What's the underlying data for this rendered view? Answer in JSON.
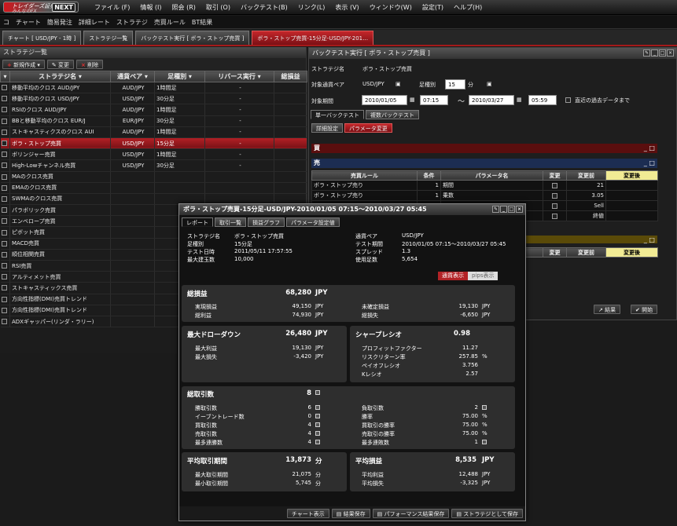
{
  "app": {
    "logo_line1": "トレイダーズ証券",
    "logo_line2": "みんなのFX",
    "logo_badge": "NEXT"
  },
  "menu": [
    "ファイル (F)",
    "情報 (I)",
    "照会 (R)",
    "取引 (O)",
    "バックテスト(B)",
    "リンク(L)",
    "表示 (V)",
    "ウィンドウ(W)",
    "設定(T)",
    "ヘルプ(H)"
  ],
  "toolbar": [
    "コ",
    "チャート",
    "簡易発注",
    "詳細レート",
    "ストラテジ",
    "売買ルール",
    "BT結果"
  ],
  "doc_tabs": [
    "チャート [ USD/JPY - 1時 ]",
    "ストラテジ一覧",
    "バックテスト実行 [ ボラ・ストップ売買 ]",
    "ボラ・ストップ売買-15分足-USD/JPY-201…"
  ],
  "strategy_list": {
    "title": "ストラテジ一覧",
    "new_label": "新規作成",
    "edit_label": "変更",
    "delete_label": "削除",
    "headers": [
      "ストラテジ名",
      "通貨ペア",
      "足種別",
      "リバース実行",
      "総損益"
    ],
    "rows": [
      {
        "name": "移動平均のクロス AUD/JPY",
        "pair": "AUD/JPY",
        "bar": "1時間足",
        "rev": "-"
      },
      {
        "name": "移動平均のクロス USD/JPY",
        "pair": "USD/JPY",
        "bar": "30分足",
        "rev": "-"
      },
      {
        "name": "RSIのクロス AUD/JPY",
        "pair": "AUD/JPY",
        "bar": "1時間足",
        "rev": "-"
      },
      {
        "name": "BBと移動平均のクロス EUR/J",
        "pair": "EUR/JPY",
        "bar": "30分足",
        "rev": "-"
      },
      {
        "name": "ストキャスティクスのクロス AUI",
        "pair": "AUD/JPY",
        "bar": "1時間足",
        "rev": "-"
      },
      {
        "name": "ボラ・ストップ売買",
        "pair": "USD/JPY",
        "bar": "15分足",
        "rev": "-"
      },
      {
        "name": "ボリンジャー売買",
        "pair": "USD/JPY",
        "bar": "1時間足",
        "rev": "-"
      },
      {
        "name": "High-Lowチャンネル売買",
        "pair": "USD/JPY",
        "bar": "30分足",
        "rev": "-"
      },
      {
        "name": "MAのクロス売買",
        "pair": "",
        "bar": "",
        "rev": ""
      },
      {
        "name": "EMAのクロス売買",
        "pair": "",
        "bar": "",
        "rev": ""
      },
      {
        "name": "SWMAのクロス売買",
        "pair": "",
        "bar": "",
        "rev": ""
      },
      {
        "name": "パラボリック売買",
        "pair": "",
        "bar": "",
        "rev": ""
      },
      {
        "name": "エンベロープ売買",
        "pair": "",
        "bar": "",
        "rev": ""
      },
      {
        "name": "ピボット売買",
        "pair": "",
        "bar": "",
        "rev": ""
      },
      {
        "name": "MACD売買",
        "pair": "",
        "bar": "",
        "rev": ""
      },
      {
        "name": "順位相関売買",
        "pair": "",
        "bar": "",
        "rev": ""
      },
      {
        "name": "RSI売買",
        "pair": "",
        "bar": "",
        "rev": ""
      },
      {
        "name": "アルティメット売買",
        "pair": "",
        "bar": "",
        "rev": ""
      },
      {
        "name": "ストキャスティックス売買",
        "pair": "",
        "bar": "",
        "rev": ""
      },
      {
        "name": "方向性指標(DMI)売買トレンド",
        "pair": "",
        "bar": "",
        "rev": ""
      },
      {
        "name": "方向性指標(DMI)売買トレンド",
        "pair": "",
        "bar": "",
        "rev": ""
      },
      {
        "name": "ADXギャッパー(リンダ・ラリー)",
        "pair": "",
        "bar": "",
        "rev": ""
      }
    ]
  },
  "backtest": {
    "title": "バックテスト実行 [ ボラ・ストップ売買 ]",
    "strategy_label": "ストラテジ名",
    "strategy_value": "ボラ・ストップ売買",
    "pair_label": "対象通貨ペア",
    "pair_value": "USD/JPY",
    "bar_label": "足種別",
    "bar_value": "15",
    "bar_unit": "分",
    "period_label": "対象期間",
    "from_date": "2010/01/05",
    "from_time": "07:15",
    "tilde": "～",
    "to_date": "2010/03/27",
    "to_time": "05:59",
    "recent_label": "直近の過去データまで",
    "tab_single": "単一バックテスト",
    "tab_multi": "複数バックテスト",
    "tab_detail": "詳細設定",
    "tab_param": "パラメータ変更",
    "buy_label": "買",
    "sell_label": "売",
    "param_headers": [
      "売買ルール",
      "条件",
      "パラメータ名",
      "変更",
      "変更前",
      "変更後"
    ],
    "param_rows": [
      {
        "rule": "ボラ・ストップ売り",
        "cond": "1",
        "name": "期間",
        "before": "21"
      },
      {
        "rule": "ボラ・ストップ売り",
        "cond": "1",
        "name": "乗数",
        "before": "3.05"
      },
      {
        "rule": "",
        "cond": "",
        "name": "",
        "before": "Sell"
      },
      {
        "rule": "",
        "cond": "",
        "name": "",
        "before": "終値"
      }
    ],
    "result_btn": "結果",
    "start_btn": "開始"
  },
  "report": {
    "title": "ボラ・ストップ売買-15分足-USD/JPY-2010/01/05 07:15～2010/03/27 05:45",
    "tabs": [
      "レポート",
      "取引一覧",
      "損益グラフ",
      "パラメータ設定値"
    ],
    "info_left": [
      [
        "ストラテジ名",
        "ボラ・ストップ売買"
      ],
      [
        "足種別",
        "15分足"
      ],
      [
        "テスト日時",
        "2011/05/11 17:57:55"
      ],
      [
        "最大建玉数",
        "10,000"
      ]
    ],
    "info_right": [
      [
        "通貨ペア",
        "USD/JPY"
      ],
      [
        "テスト期間",
        "2010/01/05 07:15～2010/03/27 05:45"
      ],
      [
        "スプレッド",
        "1.3"
      ],
      [
        "使用足数",
        "5,654"
      ]
    ],
    "toggle_currency": "通貨表示",
    "toggle_pips": "pips表示",
    "total_pl_label": "総損益",
    "total_pl_value": "68,280",
    "jpy": "JPY",
    "realized_label": "実現損益",
    "realized_value": "49,150",
    "gross_profit_label": "総利益",
    "gross_profit_value": "74,930",
    "unrealized_label": "未確定損益",
    "unrealized_value": "19,130",
    "gross_loss_label": "総損失",
    "gross_loss_value": "-6,650",
    "dd_label": "最大ドローダウン",
    "dd_value": "26,480",
    "max_profit_label": "最大利益",
    "max_profit_value": "19,130",
    "max_loss_label": "最大損失",
    "max_loss_value": "-3,420",
    "sharpe_label": "シャープレシオ",
    "sharpe_value": "0.98",
    "pf_label": "プロフィットファクター",
    "pf_value": "11.27",
    "recovery_label": "リスクリターン率",
    "recovery_value": "257.85",
    "pct": "%",
    "payoff_label": "ペイオフレシオ",
    "payoff_value": "3.756",
    "k_label": "Kレシオ",
    "k_value": "2.57",
    "trades_label": "総取引数",
    "trades_value": "8",
    "kai": "回",
    "win_trades_label": "勝取引数",
    "win_trades_value": "6",
    "even_label": "イーブントレード数",
    "even_value": "0",
    "buy_trades_label": "買取引数",
    "buy_trades_value": "4",
    "sell_trades_label": "売取引数",
    "sell_trades_value": "4",
    "max_win_streak_label": "最多連勝数",
    "max_win_streak_value": "4",
    "lose_trades_label": "負取引数",
    "lose_trades_value": "2",
    "win_rate_label": "勝率",
    "win_rate_value": "75.00",
    "buy_win_label": "買取引の勝率",
    "buy_win_value": "75.00",
    "sell_win_label": "売取引の勝率",
    "sell_win_value": "75.00",
    "max_lose_streak_label": "最多連敗数",
    "max_lose_streak_value": "1",
    "avg_period_label": "平均取引期間",
    "avg_period_value": "13,873",
    "min": "分",
    "max_period_label": "最大取引期間",
    "max_period_value": "21,075",
    "min_period_label": "最小取引期間",
    "min_period_value": "5,745",
    "avg_pl_label": "平均損益",
    "avg_pl_value": "8,535",
    "avg_profit_label": "平均利益",
    "avg_profit_value": "12,488",
    "avg_loss_label": "平均損失",
    "avg_loss_value": "-3,325",
    "footer_chart": "チャート表示",
    "footer_save": "結果保存",
    "footer_perf": "パフォーマンス結果保存",
    "footer_strat": "ストラテジとして保存"
  }
}
